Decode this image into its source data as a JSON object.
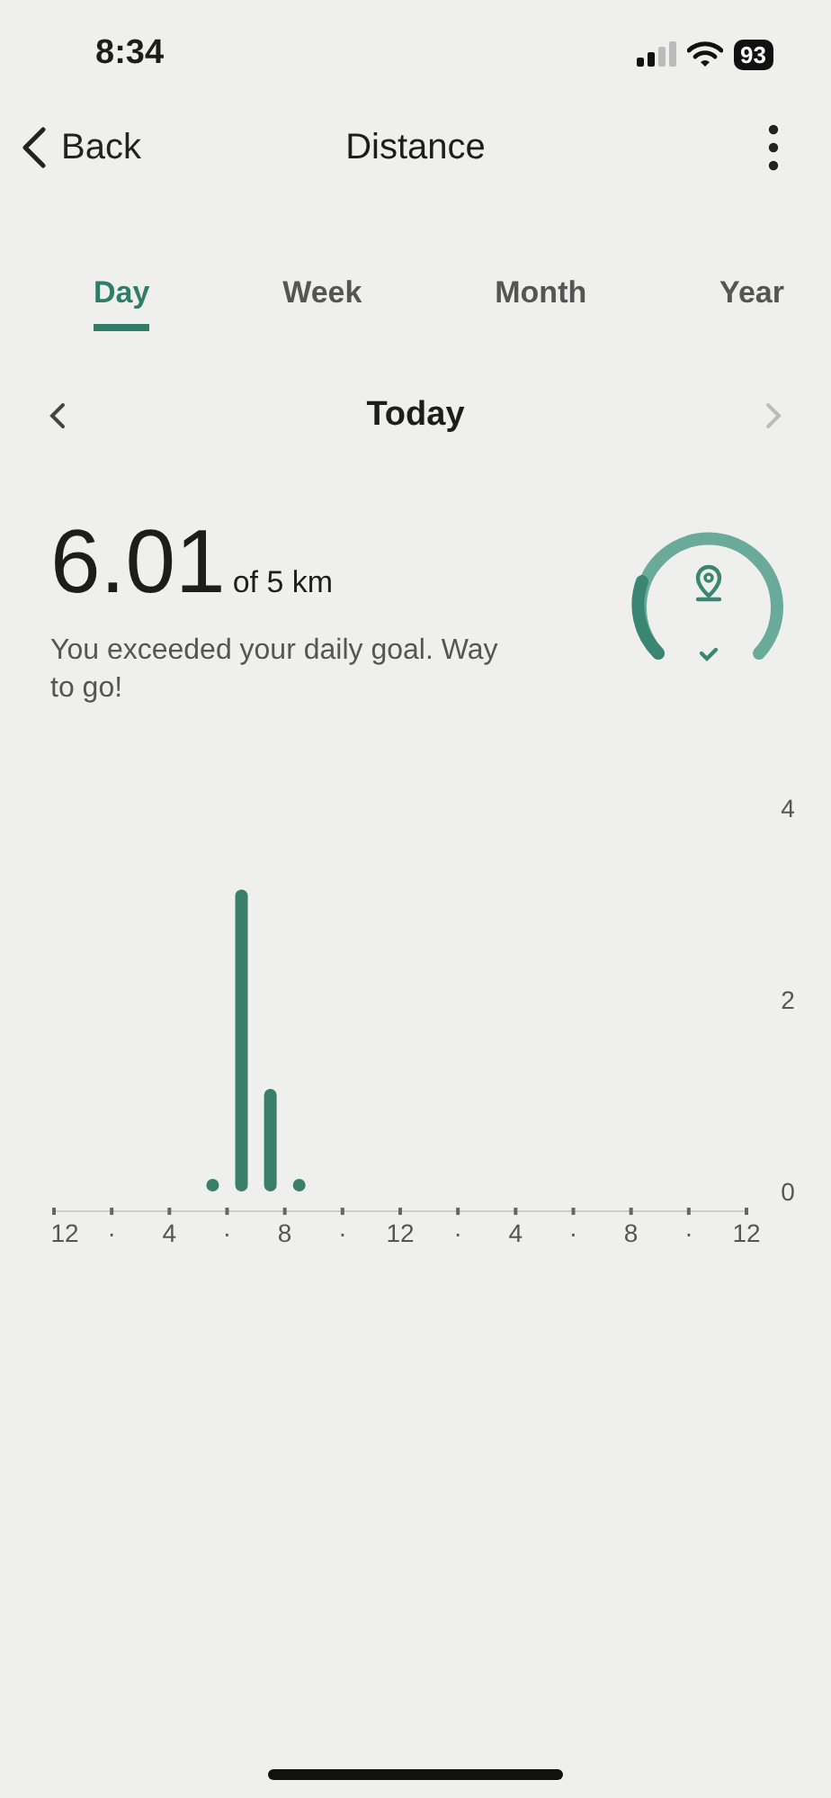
{
  "status_bar": {
    "time": "8:34",
    "battery": "93"
  },
  "nav": {
    "back": "Back",
    "title": "Distance"
  },
  "tabs": [
    {
      "label": "Day",
      "selected": true
    },
    {
      "label": "Week",
      "selected": false
    },
    {
      "label": "Month",
      "selected": false
    },
    {
      "label": "Year",
      "selected": false
    }
  ],
  "period": {
    "label": "Today",
    "next_disabled": true
  },
  "summary": {
    "value": "6.01",
    "goal": "of 5 km",
    "message": "You exceeded your daily goal. Way to go!"
  },
  "chart_data": {
    "type": "bar",
    "x": [
      5.5,
      6.5,
      7.5,
      8.5
    ],
    "values": [
      0.13,
      3.15,
      1.07,
      0.13
    ],
    "xlim": [
      0,
      24
    ],
    "ylim": [
      0,
      4
    ],
    "xticks": [
      4,
      8
    ],
    "yticks": [
      0,
      2,
      4
    ]
  },
  "other_hour_labels": [
    "12",
    "·",
    "·",
    "·",
    "12",
    "·",
    "4",
    "·",
    "8",
    "·",
    "12"
  ]
}
